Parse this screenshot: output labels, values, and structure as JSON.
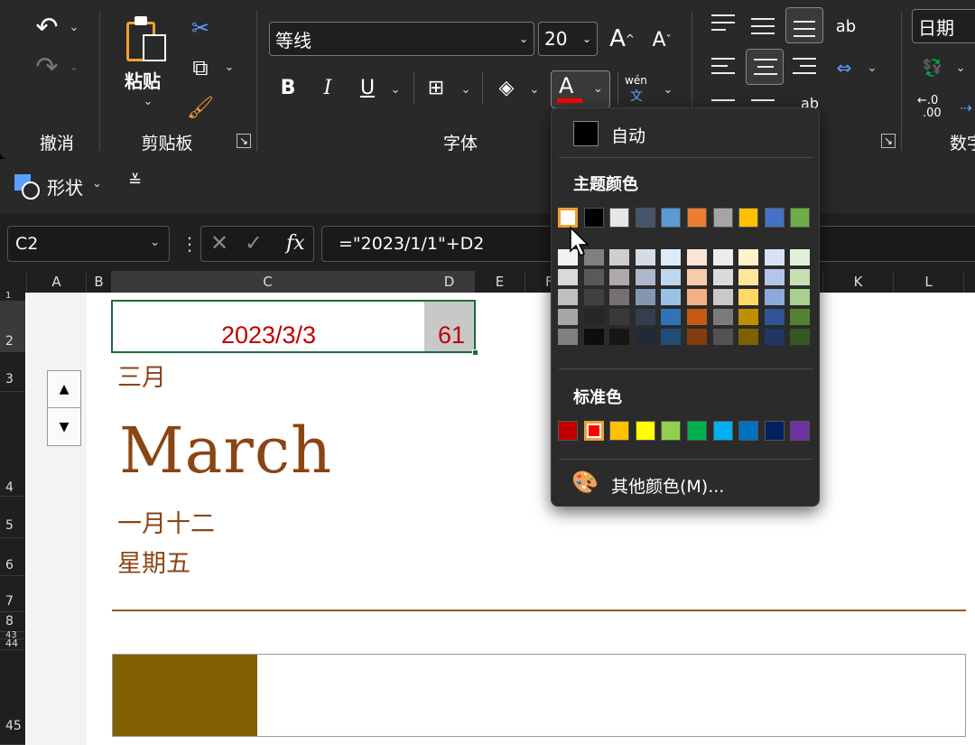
{
  "ribbon": {
    "undo_group": {
      "label": "撤消"
    },
    "clipboard": {
      "paste_label": "粘贴",
      "label": "剪贴板"
    },
    "font": {
      "font_name": "等线",
      "font_size": "20",
      "label": "字体",
      "bold": "B",
      "italic": "I",
      "underline": "U",
      "font_color_glyph": "A",
      "pinyin_top": "wén",
      "pinyin_bottom": "文"
    },
    "number": {
      "format_value": "日期",
      "label": "数字",
      "decimals_top": "←.0",
      "decimals_bottom": ".00"
    }
  },
  "shape_bar": {
    "shape_label": "形状"
  },
  "formula_bar": {
    "name_box": "C2",
    "fx": "fx",
    "formula": "=\"2023/1/1\"+D2"
  },
  "grid": {
    "columns": [
      "A",
      "B",
      "C",
      "D",
      "E",
      "F",
      "K",
      "L"
    ],
    "rows": [
      "1",
      "2",
      "3",
      "4",
      "5",
      "6",
      "7",
      "8",
      "43",
      "44",
      "45"
    ],
    "cells": {
      "c2_date": "2023/3/3",
      "d2_value": "61",
      "month_cn": "三月",
      "month_en": "March",
      "lunar_date": "一月十二",
      "weekday": "星期五"
    },
    "progress_fill": 0.17,
    "accent_brown": "#8B4513",
    "bar_color": "#806000"
  },
  "color_popup": {
    "auto_label": "自动",
    "theme_header": "主题颜色",
    "standard_header": "标准色",
    "more_label": "其他颜色(M)...",
    "theme_colors": [
      "#FFFFFF",
      "#000000",
      "#E7E6E6",
      "#44546A",
      "#5B9BD5",
      "#ED7D31",
      "#A5A5A5",
      "#FFC000",
      "#4472C4",
      "#70AD47"
    ],
    "theme_shades": [
      [
        "#F2F2F2",
        "#D9D9D9",
        "#BFBFBF",
        "#A6A6A6",
        "#808080"
      ],
      [
        "#808080",
        "#595959",
        "#404040",
        "#262626",
        "#0D0D0D"
      ],
      [
        "#D0CECE",
        "#AEAAAA",
        "#757171",
        "#3A3838",
        "#171616"
      ],
      [
        "#D6DCE4",
        "#ADB9CA",
        "#8497B0",
        "#333F4F",
        "#222A35"
      ],
      [
        "#DDEBF7",
        "#BDD7EE",
        "#9BC2E6",
        "#2F75B5",
        "#1F4E78"
      ],
      [
        "#FCE4D6",
        "#F8CBAD",
        "#F4B084",
        "#C65911",
        "#833C0C"
      ],
      [
        "#EDEDED",
        "#DBDBDB",
        "#C9C9C9",
        "#7B7B7B",
        "#525252"
      ],
      [
        "#FFF2CC",
        "#FFE699",
        "#FFD966",
        "#BF8F00",
        "#7F6000"
      ],
      [
        "#D9E1F2",
        "#B4C6E7",
        "#8EA9DB",
        "#305496",
        "#203764"
      ],
      [
        "#E2EFDA",
        "#C6E0B4",
        "#A9D08E",
        "#548235",
        "#375623"
      ]
    ],
    "standard_colors": [
      "#C00000",
      "#FF0000",
      "#FFC000",
      "#FFFF00",
      "#92D050",
      "#00B050",
      "#00B0F0",
      "#0070C0",
      "#002060",
      "#7030A0"
    ]
  }
}
